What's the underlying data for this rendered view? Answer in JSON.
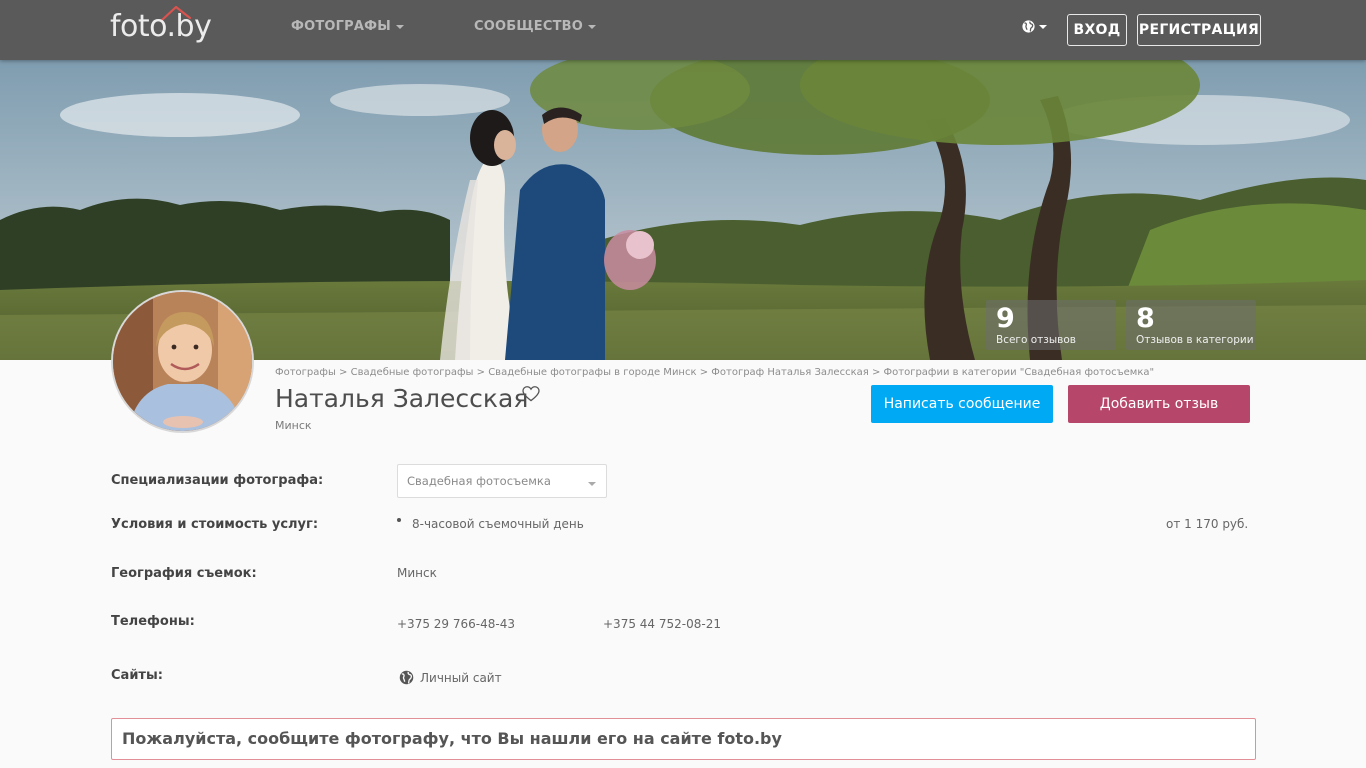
{
  "header": {
    "logo_text": "foto.by",
    "nav": [
      {
        "label": "ФОТОГРАФЫ"
      },
      {
        "label": "СООБЩЕСТВО"
      }
    ],
    "login_label": "ВХОД",
    "register_label": "РЕГИСТРАЦИЯ"
  },
  "stats": [
    {
      "value": "9",
      "label": "Всего отзывов"
    },
    {
      "value": "8",
      "label": "Отзывов в категории"
    }
  ],
  "breadcrumb": {
    "items": [
      "Фотографы",
      "Свадебные фотографы",
      "Свадебные фотографы в городе Минск",
      "Фотограф Наталья Залесская",
      "Фотографии в категории \"Свадебная фотосъемка\""
    ],
    "separator": ">"
  },
  "profile": {
    "name": "Наталья Залесская",
    "city": "Минск"
  },
  "actions": {
    "message_label": "Написать сообщение",
    "review_label": "Добавить отзыв"
  },
  "details": {
    "specialization": {
      "label": "Специализации фотографа:",
      "value": "Свадебная фотосъемка"
    },
    "services": {
      "label": "Условия и стоимость услуг:",
      "item": "8-часовой съемочный день",
      "price": "от 1 170 руб."
    },
    "geography": {
      "label": "География съемок:",
      "value": "Минск"
    },
    "phones": {
      "label": "Телефоны:",
      "values": [
        "+375 29 766-48-43",
        "+375 44 752-08-21"
      ]
    },
    "sites": {
      "label": "Сайты:",
      "value": "Личный сайт"
    }
  },
  "notice": {
    "text": "Пожалуйста, сообщите фотографу, что Вы нашли его на сайте foto.by"
  },
  "colors": {
    "topbar": "#5a5a5a",
    "message_button": "#00a9f4",
    "review_button": "#b6476a",
    "notice_border": "#e38f97"
  },
  "icons": {
    "globe": "globe-icon",
    "heart": "heart-outline-icon",
    "caret": "caret-down-icon"
  }
}
